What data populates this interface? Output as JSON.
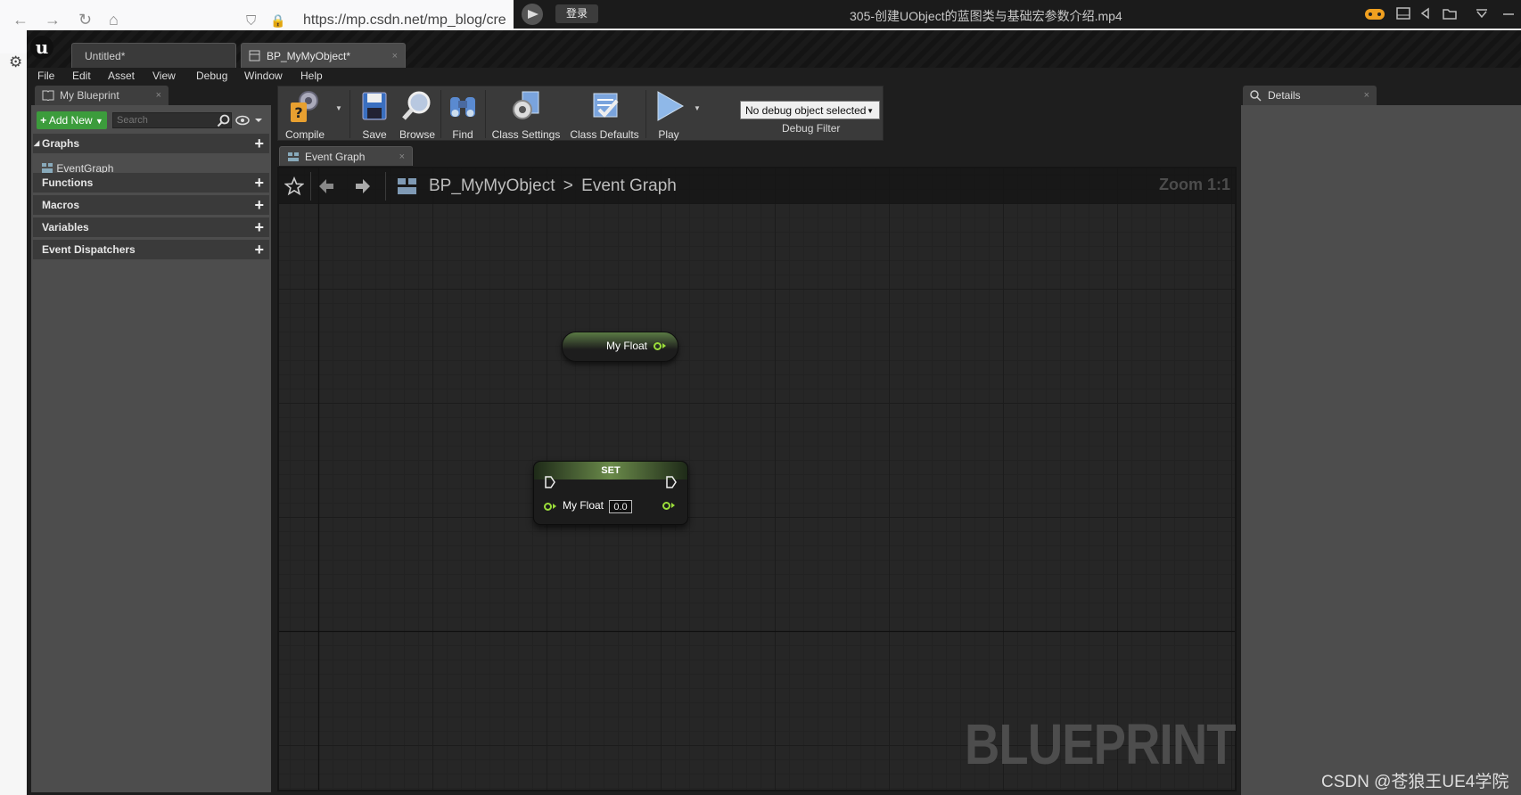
{
  "browser": {
    "url": "https://mp.csdn.net/mp_blog/cre",
    "icons": [
      "back-icon",
      "forward-icon",
      "reload-icon",
      "home-icon",
      "shield-icon",
      "lock-icon",
      "settings-icon"
    ]
  },
  "player": {
    "login_label": "登录",
    "title": "305-创建UObject的蓝图类与基础宏参数介绍.mp4"
  },
  "tabs": [
    {
      "label": "Untitled*"
    },
    {
      "label": "BP_MyMyObject*"
    }
  ],
  "tab_close": "×",
  "menu": [
    "File",
    "Edit",
    "Asset",
    "View",
    "Debug",
    "Window",
    "Help"
  ],
  "my_blueprint": {
    "tab_label": "My Blueprint",
    "add_new_label": "Add New",
    "search_placeholder": "Search",
    "sections": {
      "graphs": "Graphs",
      "functions": "Functions",
      "macros": "Macros",
      "variables": "Variables",
      "event_dispatchers": "Event Dispatchers"
    },
    "graph_items": [
      "EventGraph"
    ]
  },
  "toolbar": {
    "compile": "Compile",
    "save": "Save",
    "browse": "Browse",
    "find": "Find",
    "class_settings": "Class Settings",
    "class_defaults": "Class Defaults",
    "play": "Play",
    "debug_selected": "No debug object selected",
    "debug_filter": "Debug Filter"
  },
  "graph": {
    "tab_label": "Event Graph",
    "breadcrumb_blueprint": "BP_MyMyObject",
    "breadcrumb_separator": ">",
    "breadcrumb_graph": "Event Graph",
    "zoom": "Zoom 1:1",
    "watermark": "BLUEPRINT"
  },
  "nodes": {
    "get_label": "My Float",
    "set_title": "SET",
    "set_pin_label": "My Float",
    "set_value": "0.0"
  },
  "details": {
    "tab_label": "Details"
  },
  "overlay": {
    "csdn": "CSDN @苍狼王UE4学院"
  },
  "colors": {
    "add_new": "#3c9c3c",
    "float_pin": "#9bdd3a",
    "panel": "#4d4d4d",
    "canvas": "#262626"
  }
}
